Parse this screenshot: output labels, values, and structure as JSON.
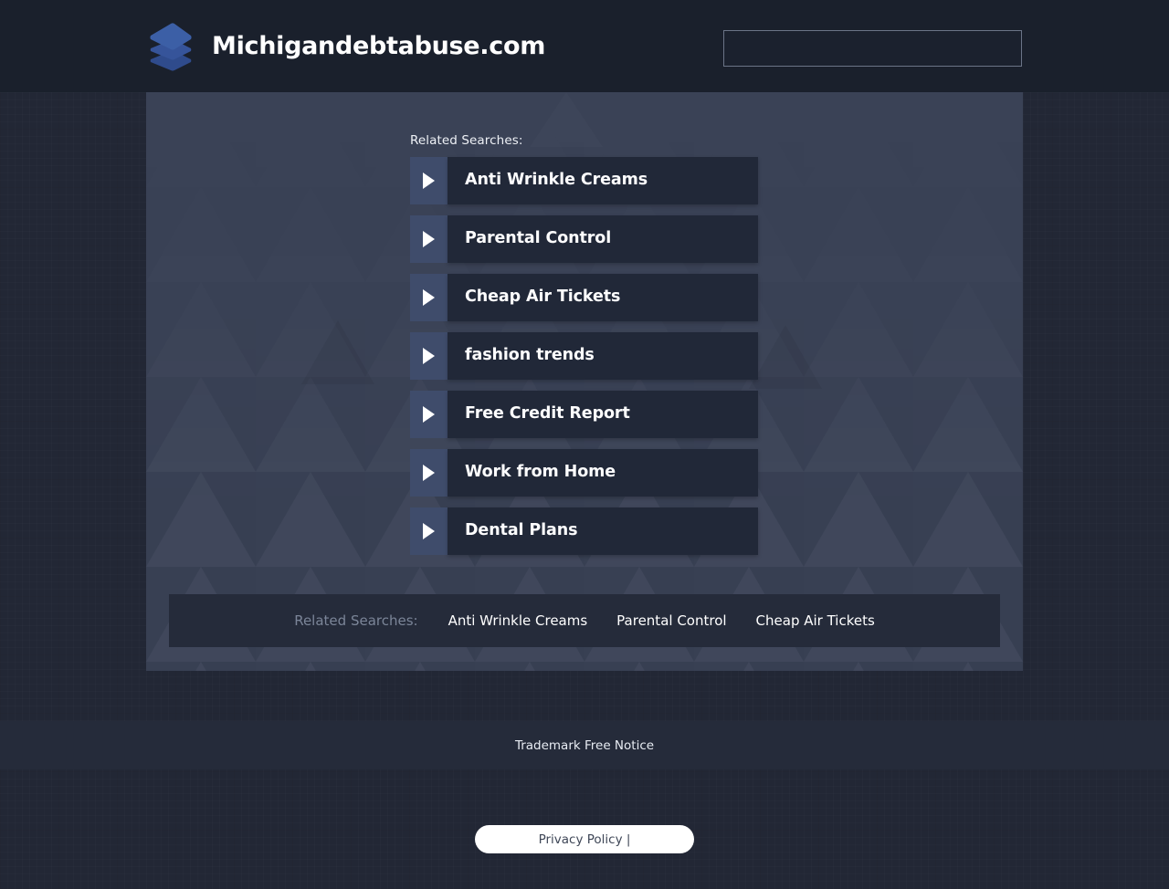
{
  "header": {
    "brand_title": "Michigandebtabuse.com",
    "logo_icon": "stacked-layers-icon",
    "logo_colors": {
      "top": "#3c5fa6",
      "mid": "#36549a",
      "bottom": "#2f4b8c"
    },
    "search": {
      "value": "",
      "placeholder": ""
    }
  },
  "main": {
    "related_label": "Related Searches:",
    "items": [
      {
        "label": "Anti Wrinkle Creams",
        "icon": "play-arrow-icon"
      },
      {
        "label": "Parental Control",
        "icon": "play-arrow-icon"
      },
      {
        "label": "Cheap Air Tickets",
        "icon": "play-arrow-icon"
      },
      {
        "label": "fashion trends",
        "icon": "play-arrow-icon"
      },
      {
        "label": "Free Credit Report",
        "icon": "play-arrow-icon"
      },
      {
        "label": "Work from Home",
        "icon": "play-arrow-icon"
      },
      {
        "label": "Dental Plans",
        "icon": "play-arrow-icon"
      }
    ]
  },
  "footer_links": {
    "label": "Related Searches:",
    "links": [
      {
        "label": "Anti Wrinkle Creams"
      },
      {
        "label": "Parental Control"
      },
      {
        "label": "Cheap Air Tickets"
      }
    ]
  },
  "notice": {
    "text": "Trademark Free Notice"
  },
  "privacy": {
    "text": "Privacy Policy |"
  },
  "colors": {
    "header_bg": "#1a202c",
    "page_bg": "#222735",
    "container_bg": "#3a4256",
    "item_bg": "#212838",
    "item_arrow_bg": "#3f4c6b",
    "bar_bg": "#252b3a",
    "accent_blue": "#3c5fa6",
    "muted_text": "#7b8598",
    "white": "#ffffff"
  }
}
